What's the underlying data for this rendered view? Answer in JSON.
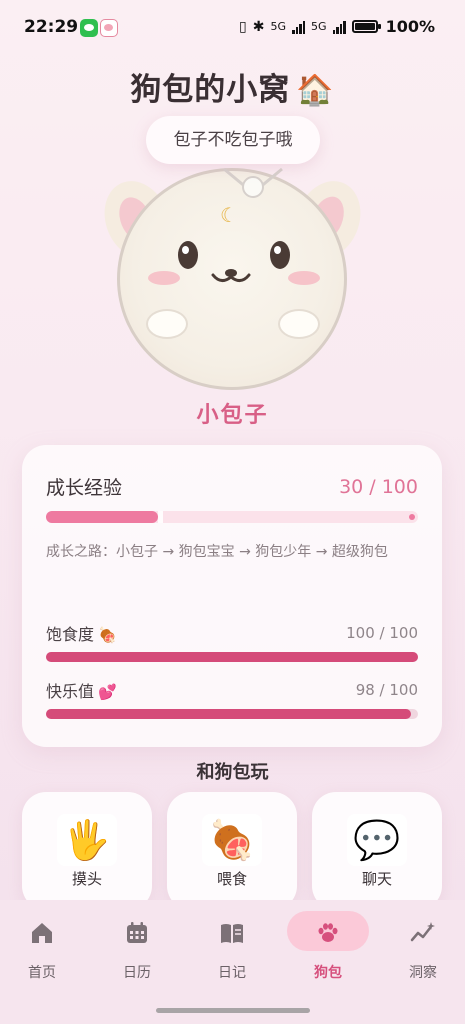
{
  "status_bar": {
    "time": "22:29",
    "network": "5G",
    "network2": "5G",
    "battery_percent": "100%",
    "battery_level": 1.0
  },
  "header": {
    "title": "狗包的小窝",
    "title_emoji": "🏠"
  },
  "pet": {
    "speech": "包子不吃包子哦",
    "name": "小包子"
  },
  "growth": {
    "label": "成长经验",
    "value_text": "30 / 100",
    "current": 30,
    "max": 100,
    "path_text": "成长之路：小包子 → 狗包宝宝 → 狗包少年 → 超级狗包"
  },
  "stats": [
    {
      "label": "饱食度",
      "emoji": "🍖",
      "value_text": "100 / 100",
      "current": 100,
      "max": 100
    },
    {
      "label": "快乐值",
      "emoji": "💕",
      "value_text": "98 / 100",
      "current": 98,
      "max": 100
    }
  ],
  "play": {
    "title": "和狗包玩",
    "actions": [
      {
        "label": "摸头",
        "emoji": "🖐"
      },
      {
        "label": "喂食",
        "emoji": "🍖"
      },
      {
        "label": "聊天",
        "emoji": "💬"
      }
    ]
  },
  "nav": {
    "items": [
      {
        "label": "首页",
        "icon": "home-icon"
      },
      {
        "label": "日历",
        "icon": "calendar-icon"
      },
      {
        "label": "日记",
        "icon": "book-icon"
      },
      {
        "label": "狗包",
        "icon": "paw-icon",
        "active": true
      },
      {
        "label": "洞察",
        "icon": "insight-icon"
      }
    ]
  },
  "colors": {
    "accent": "#d85f86",
    "exp_bar": "#ee7aa0",
    "stat_bar": "#d54b79",
    "background": "#f8ebf2"
  }
}
